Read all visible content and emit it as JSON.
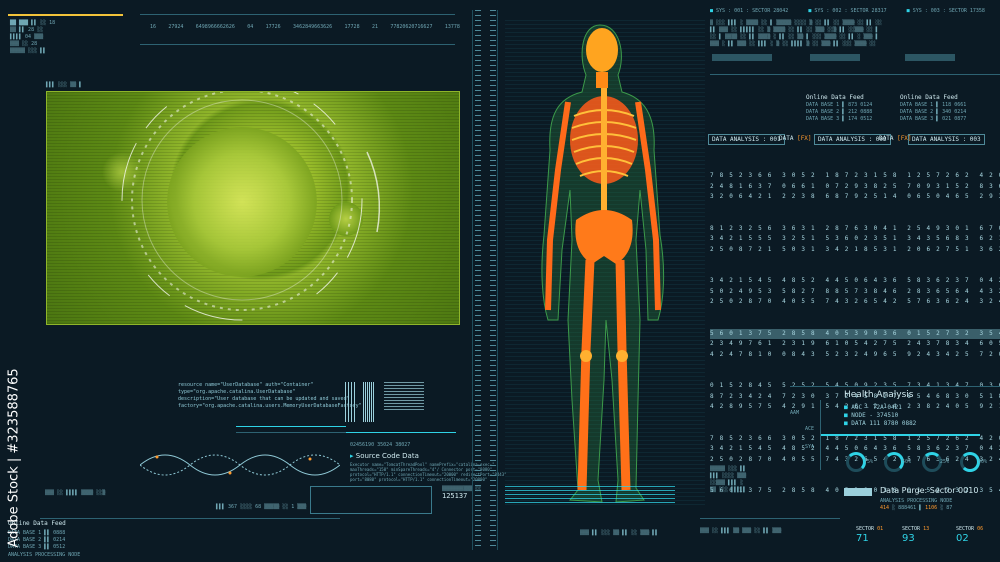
{
  "top_header": {
    "sectors": [
      {
        "sys": "SYS",
        "num": "001",
        "label": "SECTOR 28042"
      },
      {
        "sys": "SYS",
        "num": "002",
        "label": "SECTOR 28317"
      },
      {
        "sys": "SYS",
        "num": "003",
        "label": "SECTOR 17358"
      }
    ],
    "left_numbers": [
      "16",
      "27924",
      "6498966662626",
      "04",
      "17726",
      "3462849663626",
      "17728",
      "21",
      "77820620716627",
      "13778"
    ]
  },
  "online_feed": [
    {
      "title": "Online Data Feed",
      "rows": [
        "DATA BASE 1",
        "DATA BASE 2",
        "DATA BASE 3"
      ]
    },
    {
      "title": "Online Data Feed",
      "rows": [
        "DATA BASE 1",
        "DATA BASE 2",
        "DATA BASE 3"
      ]
    }
  ],
  "analysis_tabs": [
    {
      "label": "DATA ANALYSIS : 001"
    },
    {
      "label": "DATA"
    },
    {
      "label": "DATA ANALYSIS : 002"
    },
    {
      "label": "DATA"
    },
    {
      "label": "DATA ANALYSIS : 003"
    }
  ],
  "number_grid": [
    "7 8 5 2 3 6 6  3 0 5 2  1 8 7 2 3 1 5 8  1 2 5 7 2 6 2  4 2 0 8 2 4 3",
    "2 4 8 1 6 3 7  0 6 6 1  0 7 2 9 3 8 2 5  7 0 9 3 1 5 2  8 3 6 0 2 0 4",
    "3 2 0 6 4 2 1  2 2 3 8  6 8 7 9 2 5 1 4  0 6 5 0 4 6 5  2 9 3 7 1 3 8",
    "8 1 2 3 2 5 6  3 6 3 1  2 8 7 6 3 0 4 1  2 5 4 9 3 0 1  6 7 0 5 1 6 7",
    "3 4 2 1 5 5 5  3 2 5 1  5 3 6 0 2 3 5 1  3 4 3 5 6 8 3  6 2 1 7 3 0 2",
    "2 5 0 8 7 2 1  5 0 3 1  3 4 2 1 8 5 3 1  2 0 6 2 7 5 1  3 6 2 3 2 9 4",
    "3 4 2 1 5 4 5  4 8 5 2  4 4 5 0 6 4 3 6  5 8 3 6 2 3 7  0 4 2 1 7 6 5",
    "5 0 2 4 9 5 3  5 8 2 7  8 8 5 7 3 8 4 6  2 8 3 6 5 6 4  4 3 2 1 7 0 6",
    "2 5 0 2 8 7 0  4 0 5 5  7 4 3 2 6 5 4 2  5 7 6 3 6 2 4  3 2 4 6 5 7 1",
    "5 6 0 1 3 7 5  2 8 5 8  4 0 5 3 9 0 3 6  0 1 5 2 7 3 2  3 5 4 9 0 2 4",
    "2 3 4 9 7 6 1  2 3 1 9  6 1 0 5 4 2 7 5  2 4 3 7 8 3 4  6 0 5 5 3 0 2",
    "4 2 4 7 8 1 0  0 8 4 3  5 2 3 2 4 9 6 5  9 2 4 3 4 2 5  7 2 0 1 6 4 1",
    "0 1 5 2 8 4 5  5 2 5 2  5 4 5 0 9 2 3 5  7 3 4 1 3 4 7  0 3 6 4 5 8 7",
    "8 7 2 3 4 2 4  7 2 3 0  3 7 2 4 5 8 2 7  6 5 4 6 8 3 0  5 1 8 7 2 4 6",
    "4 2 8 9 5 7 5  4 2 9 1  5 4 2 6 3 2 1 4  2 3 8 2 4 0 5  9 2 1 3 6 8 4",
    "7 8 5 2 3 6 6  3 0 5 2  1 8 7 2 3 1 5 8  1 2 5 7 2 6 2  4 2 0 8 2 4 3",
    "3 4 2 1 5 4 5  4 8 5 2  4 4 5 0 6 4 3 6  5 8 3 6 2 3 7  0 4 2 1 7 6 5",
    "2 5 0 2 8 7 0  4 0 5 5  7 4 3 2 6 5 4 2  5 7 6 3 6 2 4  3 2 4 6 5 7 1",
    "5 6 0 1 3 7 5  2 8 5 8  4 0 5 3 9 0 3 6  0 1 5 2 7 3 2  3 5 4 9 0 2 4"
  ],
  "health": {
    "title": "Health Analysis",
    "rows": [
      {
        "key": "AGC",
        "value": "T2A 0421"
      },
      {
        "key": "NODE",
        "value": "374510"
      },
      {
        "key": "DATA",
        "value": "111  8780 0882"
      }
    ],
    "axis": [
      "AAM",
      "ACE",
      "SYA"
    ]
  },
  "gauges": [
    {
      "value": "75%",
      "percent": 0.75
    },
    {
      "value": "50%",
      "percent": 0.5
    },
    {
      "value": "25%",
      "percent": 0.25
    },
    {
      "value": "90%",
      "percent": 0.9
    }
  ],
  "purge": {
    "title": "Data Purge: Sector 0010",
    "sub": "ANALYSIS PROCESSING NODE",
    "values": [
      "414",
      "888461",
      "1106",
      "87"
    ]
  },
  "sectors_bottom": [
    {
      "label": "SECTOR",
      "code": "01",
      "value": "71"
    },
    {
      "label": "SECTOR",
      "code": "13",
      "value": "93"
    },
    {
      "label": "SECTOR",
      "code": "06",
      "value": "02"
    }
  ],
  "code_panel": {
    "lines": [
      "resource name=\"UserDatabase\" auth=\"Container\"",
      "type=\"org.apache.catalina.UserDatabase\"",
      "description=\"User database that can be updated and saved\"",
      "factory=\"org.apache.catalina.users.MemoryUserDatabaseFactory\""
    ],
    "source_title": "Source Code Data",
    "source_lines": [
      "Executor name=\"TomcatThreadPool\" namePrefix=\"catalina-exec-\"",
      "maxThreads=\"150\" minSpareThreads=\"4\"/ Connector port=\"8080\"",
      "protocol=\"HTTP/1.1\" connectionTimeout=\"20000\" redirectPort=\"8443\"",
      "port=\"8080\" protocol=\"HTTP/1.1\" connectionTimeout=\"20000\""
    ],
    "counter": "125137",
    "numbers": [
      "02456190",
      "35024",
      "38027"
    ]
  },
  "left_bottom": {
    "title": "Online Data Feed",
    "sub": "ANALYSIS PROCESSING NODE",
    "rows": [
      "DATA BASE 1",
      "DATA BASE 2",
      "DATA BASE 3"
    ]
  },
  "watermark": {
    "side": "Adobe Stock | #323588765"
  },
  "colors": {
    "accent": "#2fd3e6",
    "bone": "#ff6a1a",
    "virus": "#8fb52a"
  }
}
